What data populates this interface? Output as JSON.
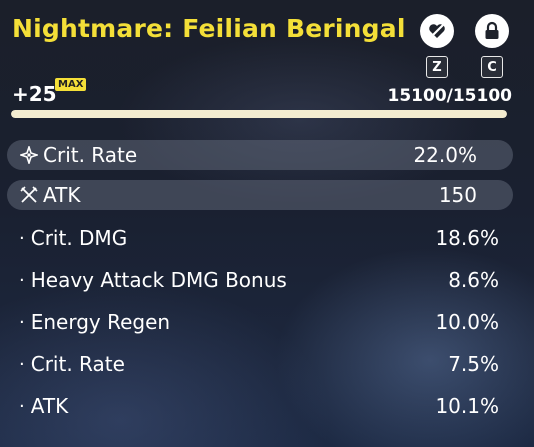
{
  "echo": {
    "name": "Nightmare: Feilian Beringal",
    "level": "+25",
    "max_badge": "MAX",
    "exp_text": "15100/15100",
    "exp_progress": 1.0
  },
  "actions": {
    "discard": {
      "icon": "discard-heart-icon",
      "key": "Z"
    },
    "lock": {
      "icon": "lock-icon",
      "key": "C"
    }
  },
  "main_stats": [
    {
      "label": "Crit. Rate",
      "value": "22.0%",
      "icon": "crit-rate-icon"
    },
    {
      "label": "ATK",
      "value": "150",
      "icon": "atk-swords-icon"
    }
  ],
  "sub_stats": [
    {
      "label": "Crit. DMG",
      "value": "18.6%"
    },
    {
      "label": "Heavy Attack DMG Bonus",
      "value": "8.6%"
    },
    {
      "label": "Energy Regen",
      "value": "10.0%"
    },
    {
      "label": "Crit. Rate",
      "value": "7.5%"
    },
    {
      "label": "ATK",
      "value": "10.1%"
    }
  ],
  "colors": {
    "title": "#f4df38",
    "bar_fill": "#f3ecd0",
    "row_bg": "#5f6676"
  }
}
